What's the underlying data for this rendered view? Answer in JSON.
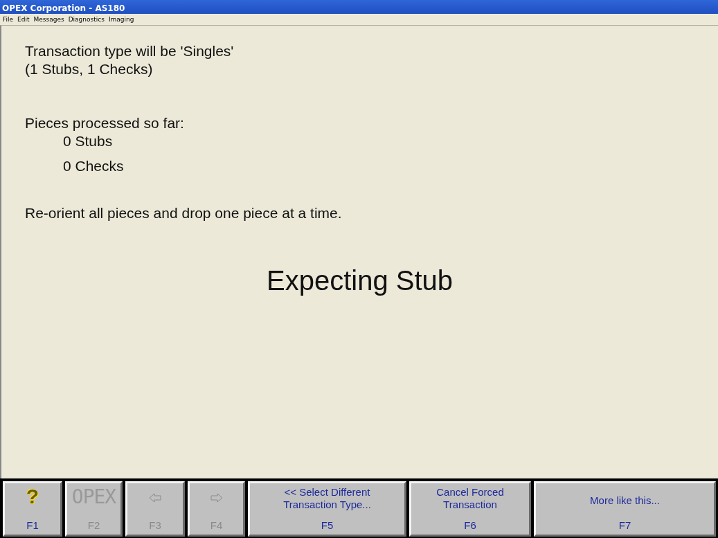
{
  "window": {
    "title": "OPEX Corporation  - AS180"
  },
  "menu": [
    "File",
    "Edit",
    "Messages",
    "Diagnostics",
    "Imaging"
  ],
  "content": {
    "transaction_lines": [
      "Transaction type will be 'Singles'",
      "(1 Stubs, 1 Checks)"
    ],
    "processed_heading": "Pieces processed so far:",
    "processed_counts": [
      "0 Stubs",
      "0 Checks"
    ],
    "instruction": "Re-orient all pieces and drop one piece at a time.",
    "status": "Expecting Stub"
  },
  "function_keys": [
    {
      "kind": "help",
      "glyph": "?",
      "key": "F1",
      "disabled": false
    },
    {
      "kind": "logo",
      "logo_text": "OPEX",
      "key": "F2",
      "disabled": true
    },
    {
      "kind": "arrow-left",
      "key": "F3",
      "disabled": true
    },
    {
      "kind": "arrow-right",
      "key": "F4",
      "disabled": true
    },
    {
      "kind": "text",
      "lines": [
        "<< Select Different",
        "Transaction Type..."
      ],
      "key": "F5",
      "disabled": false
    },
    {
      "kind": "text",
      "lines": [
        "Cancel Forced",
        "Transaction"
      ],
      "key": "F6",
      "disabled": false
    },
    {
      "kind": "text",
      "lines": [
        "More like this..."
      ],
      "key": "F7",
      "disabled": false
    }
  ]
}
